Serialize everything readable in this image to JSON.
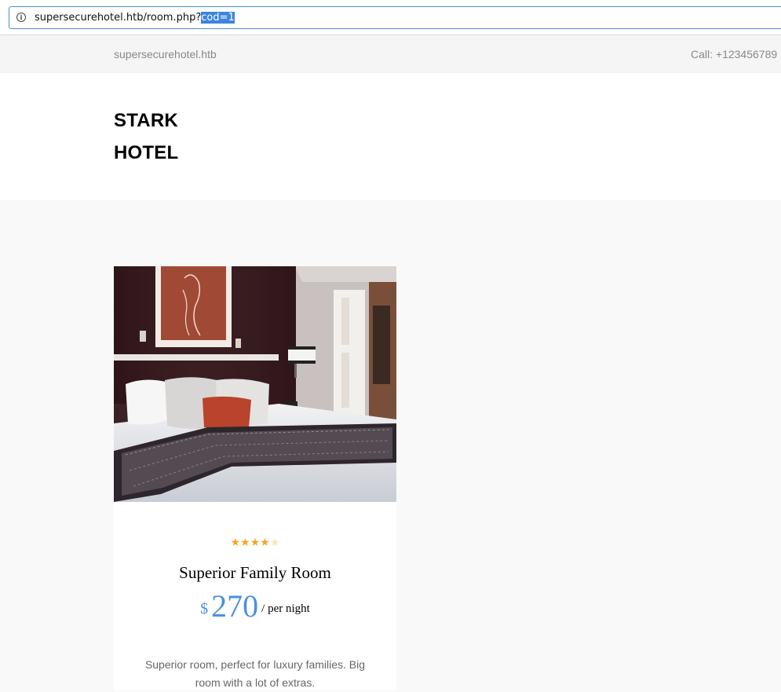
{
  "browser": {
    "url_base": "supersecurehotel.htb/room.php?",
    "url_selected": "cod=1",
    "info_icon": "info-icon"
  },
  "topbar": {
    "site_name": "supersecurehotel.htb",
    "call": "Call: +123456789"
  },
  "header": {
    "logo_line1": "STARK",
    "logo_line2": "HOTEL"
  },
  "room": {
    "rating": 4,
    "rating_max": 5,
    "title": "Superior Family Room",
    "currency": "$",
    "price": "270",
    "per": "/ per night",
    "description": "Superior room, perfect for luxury families. Big room with a lot of extras."
  },
  "colors": {
    "accent": "#4a90e2",
    "star": "#f5a623",
    "selection": "#3d84dc"
  }
}
